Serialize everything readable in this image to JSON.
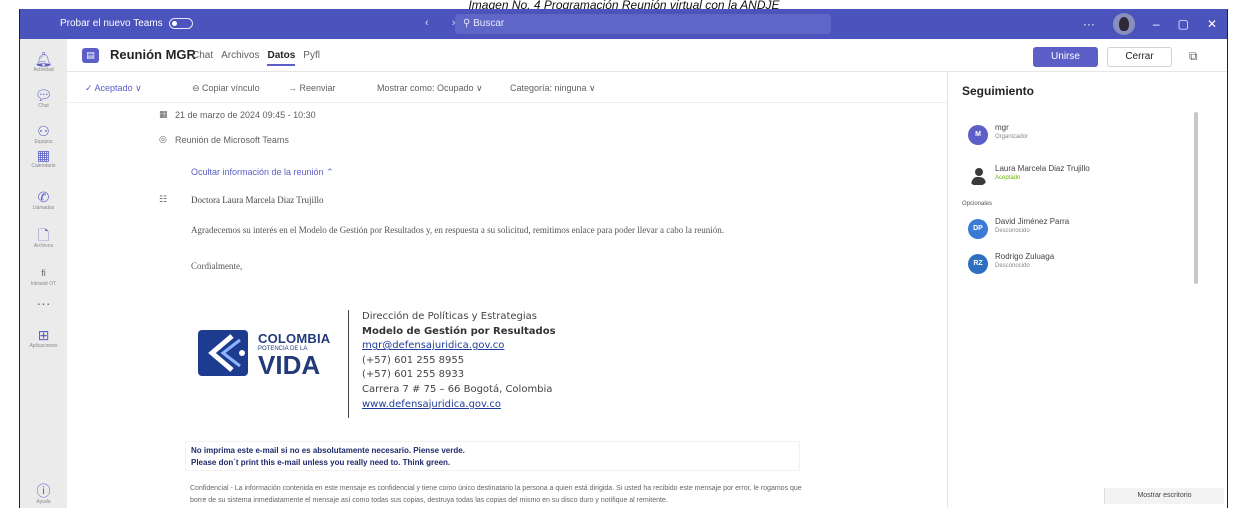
{
  "caption": "Imagen No. 4 Programación Reunión virtual con la ANDJE",
  "titlebar": {
    "toggle_label": "Probar el nuevo Teams",
    "nav_arrows": "‹ ›",
    "search_placeholder": "Buscar",
    "more": "···",
    "minimize": "–",
    "maximize": "▢",
    "close": "✕"
  },
  "rail": {
    "items": [
      {
        "icon": "bell-icon",
        "glyph": "🔔︎",
        "label": "Actividad"
      },
      {
        "icon": "chat-icon",
        "glyph": "💬︎",
        "label": "Chat"
      },
      {
        "icon": "teams-icon",
        "glyph": "⚇",
        "label": "Equipos"
      },
      {
        "icon": "calendar-icon",
        "glyph": "▦",
        "label": "Calendario"
      },
      {
        "icon": "phone-icon",
        "glyph": "✆",
        "label": "Llamadas"
      },
      {
        "icon": "file-icon",
        "glyph": "🗋",
        "label": "Archivos"
      },
      {
        "icon": "app-icon",
        "glyph": "fi",
        "label": "Intranet OT"
      },
      {
        "icon": "more-icon",
        "glyph": "···",
        "label": ""
      },
      {
        "icon": "apps-icon",
        "glyph": "⊞",
        "label": "Aplicaciones"
      },
      {
        "icon": "help-icon",
        "glyph": "ⓘ",
        "label": "Ayuda"
      }
    ]
  },
  "meeting": {
    "title": "Reunión MGR",
    "tabs": [
      "Chat",
      "Archivos",
      "Datos",
      "Pyfl"
    ],
    "active_tab": "Datos",
    "join_label": "Unirse",
    "close_label": "Cerrar"
  },
  "toolbar": {
    "accepted": "✓ Aceptado ∨",
    "copy_link": "⊖ Copiar vínculo",
    "forward": "→ Reenviar",
    "show_as": "Mostrar como: Ocupado ∨",
    "category": "Categoría: ninguna ∨"
  },
  "details": {
    "date": "21 de marzo de 2024 09:45 - 10:30",
    "location": "Reunión de Microsoft Teams",
    "hide_info": "Ocultar información de la reunión  ⌃",
    "greeting": "Doctora Laura Marcela Diaz Trujillo",
    "body": "Agradecemos su interés en el Modelo de Gestión por Resultados y, en respuesta a su solicitud, remitimos enlace para poder llevar a cabo la reunión.",
    "closing": "Cordialmente,"
  },
  "signature": {
    "logo_line1": "COLOMBIA",
    "logo_line2": "POTENCIA DE LA",
    "logo_line3": "VIDA",
    "line1": "Dirección de Políticas y Estrategias",
    "line2": "Modelo de Gestión por Resultados",
    "email": "mgr@defensajuridica.gov.co",
    "phone1": "(+57) 601 255 8955",
    "phone2": "(+57) 601 255 8933",
    "address": "Carrera 7 # 75 – 66 Bogotá, Colombia",
    "web": "www.defensajuridica.gov.co"
  },
  "notice": {
    "line1": "No imprima este e-mail si no es absolutamente necesario. Piense verde.",
    "line2": "Please don´t print this e-mail unless you really need to. Think green."
  },
  "legal": "Confidencial - La información contenida en este mensaje es confidencial y tiene como único destinatario la persona a quien está dirigida. Si usted ha recibido este mensaje por error, le rogamos que borre de su sistema inmediatamente el mensaje así como todas sus copias, destruya todas las copias del mismo en su disco duro y notifique al remitente.",
  "tracking": {
    "title": "Seguimiento",
    "optional_label": "Opcionales",
    "people": [
      {
        "initials": "M",
        "name": "mgr",
        "status": "Organizador",
        "color": "#5b5fc7"
      },
      {
        "initials": "",
        "name": "Laura Marcela Diaz Trujillo",
        "status": "Aceptado",
        "color": "#3a3a3a"
      },
      {
        "initials": "DP",
        "name": "David Jiménez Parra",
        "status": "Desconocido",
        "color": "#3a7bd5"
      },
      {
        "initials": "RZ",
        "name": "Rodrigo Zuluaga",
        "status": "Desconocido",
        "color": "#2f6fbf"
      }
    ]
  },
  "show_desktop": "Mostrar escritorio"
}
